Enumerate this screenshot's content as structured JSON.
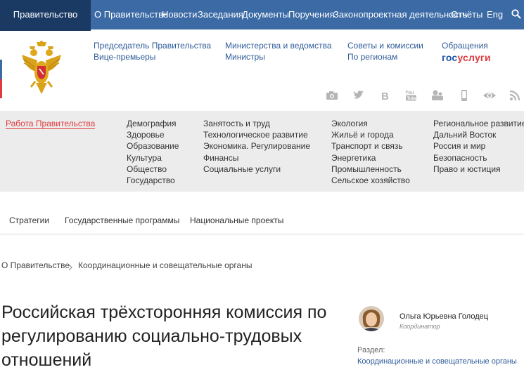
{
  "topnav": {
    "brand": "Правительство России",
    "items": [
      "О Правительстве",
      "Новости",
      "Заседания",
      "Документы",
      "Поручения",
      "Законопроектная деятельность",
      "Отчёты",
      "Eng"
    ]
  },
  "header": {
    "links": [
      "Председатель Правительства",
      "Вице-премьеры",
      "Министерства и ведомства",
      "Министры",
      "Советы и комиссии",
      "По регионам",
      "Обращения"
    ],
    "gosuslugi_part1": "гос",
    "gosuslugi_part2": "услуги",
    "social_icons": [
      "camera-icon",
      "twitter-icon",
      "vk-icon",
      "youtube-icon",
      "people-icon",
      "mobile-icon",
      "eye-icon",
      "rss-icon"
    ]
  },
  "topics": {
    "active": "Работа Правительства",
    "col1": [
      "Демография",
      "Здоровье",
      "Образование",
      "Культура",
      "Общество",
      "Государство"
    ],
    "col2": [
      "Занятость и труд",
      "Технологическое развитие",
      "Экономика. Регулирование",
      "Финансы",
      "Социальные услуги"
    ],
    "col3": [
      "Экология",
      "Жильё и города",
      "Транспорт и связь",
      "Энергетика",
      "Промышленность",
      "Сельское хозяйство"
    ],
    "col4": [
      "Региональное развитие",
      "Дальний Восток",
      "Россия и мир",
      "Безопасность",
      "Право и юстиция"
    ]
  },
  "programs": [
    "Стратегии",
    "Государственные программы",
    "Национальные проекты"
  ],
  "breadcrumb": [
    "О Правительстве",
    "Координационные и совещательные органы"
  ],
  "page": {
    "title": "Российская трёхсторонняя комиссия по регулированию социально-трудовых отношений"
  },
  "coordinator": {
    "name": "Ольга Юрьевна Голодец",
    "role": "Координатор"
  },
  "section": {
    "label": "Раздел:",
    "link": "Координационные и совещательные органы"
  },
  "colors": {
    "topbar": "#3b6aa5",
    "brand_bg": "#1b3a63",
    "link": "#2f5c9a",
    "accent_red": "#e03a3e",
    "topics_bg": "#ececec"
  }
}
